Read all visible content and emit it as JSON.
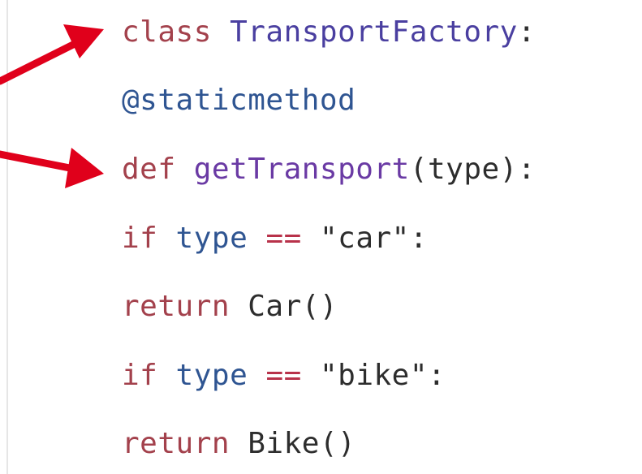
{
  "code": {
    "line1": {
      "kw": "class",
      "name": "TransportFactory",
      "punct": ":"
    },
    "line2": {
      "decorator": "@staticmethod"
    },
    "line3": {
      "kw": "def",
      "name": "getTransport",
      "args": "(type):"
    },
    "line4": {
      "kw": "if",
      "var": "type",
      "op": "==",
      "str": "\"car\"",
      "punct": ":"
    },
    "line5": {
      "kw": "return",
      "call": "Car()"
    },
    "line6": {
      "kw": "if",
      "var": "type",
      "op": "==",
      "str": "\"bike\"",
      "punct": ":"
    },
    "line7": {
      "kw": "return",
      "call": "Bike()"
    }
  },
  "colors": {
    "arrow": "#e0001b",
    "keyword": "#a3414c",
    "class_name": "#4a3fa0",
    "decorator": "#2f5592"
  }
}
